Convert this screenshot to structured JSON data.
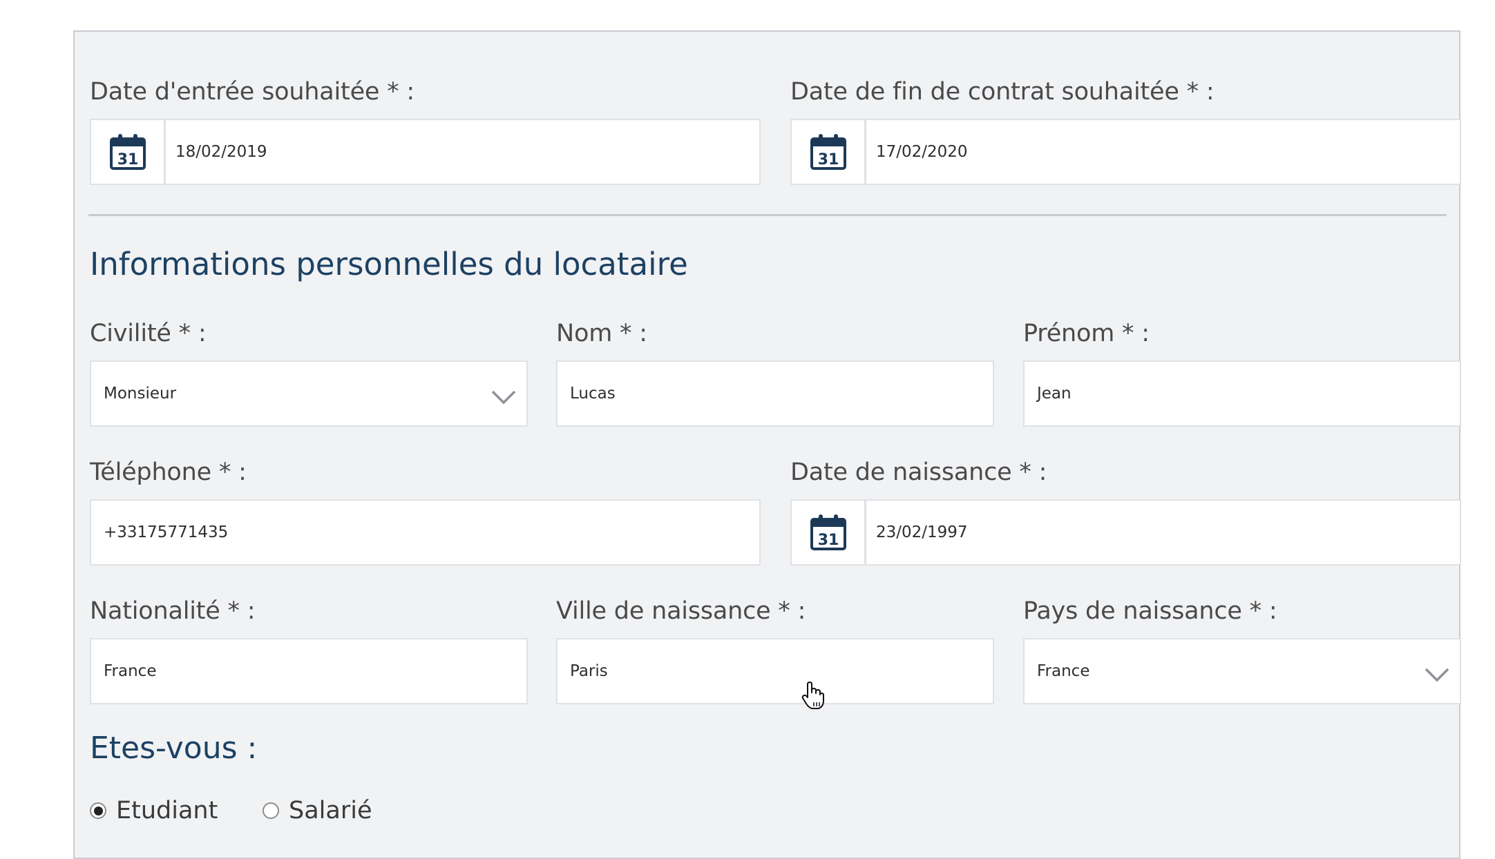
{
  "form": {
    "date_entree": {
      "label": "Date d'entrée souhaitée * :",
      "value": "18/02/2019",
      "icon": "calendar-icon",
      "icon_day": "31"
    },
    "date_fin": {
      "label": "Date de fin de contrat souhaitée * :",
      "value": "17/02/2020",
      "icon": "calendar-icon",
      "icon_day": "31"
    },
    "section_title": "Informations personnelles du locataire",
    "civilite": {
      "label": "Civilité * :",
      "value": "Monsieur"
    },
    "nom": {
      "label": "Nom * :",
      "value": "Lucas"
    },
    "prenom": {
      "label": "Prénom * :",
      "value": "Jean"
    },
    "telephone": {
      "label": "Téléphone * :",
      "value": "+33175771435"
    },
    "date_naissance": {
      "label": "Date de naissance * :",
      "value": "23/02/1997",
      "icon": "calendar-icon",
      "icon_day": "31"
    },
    "nationalite": {
      "label": "Nationalité * :",
      "value": "France"
    },
    "ville_naissance": {
      "label": "Ville de naissance * :",
      "value": "Paris"
    },
    "pays_naissance": {
      "label": "Pays de naissance * :",
      "value": "France"
    },
    "status_title": "Etes-vous :",
    "status_options": [
      {
        "label": "Etudiant",
        "checked": true
      },
      {
        "label": "Salarié",
        "checked": false
      }
    ]
  },
  "colors": {
    "heading": "#1c4163",
    "icon": "#1c3a57",
    "panel_bg": "#f1f2f4",
    "field_border": "#dfe1e4"
  }
}
